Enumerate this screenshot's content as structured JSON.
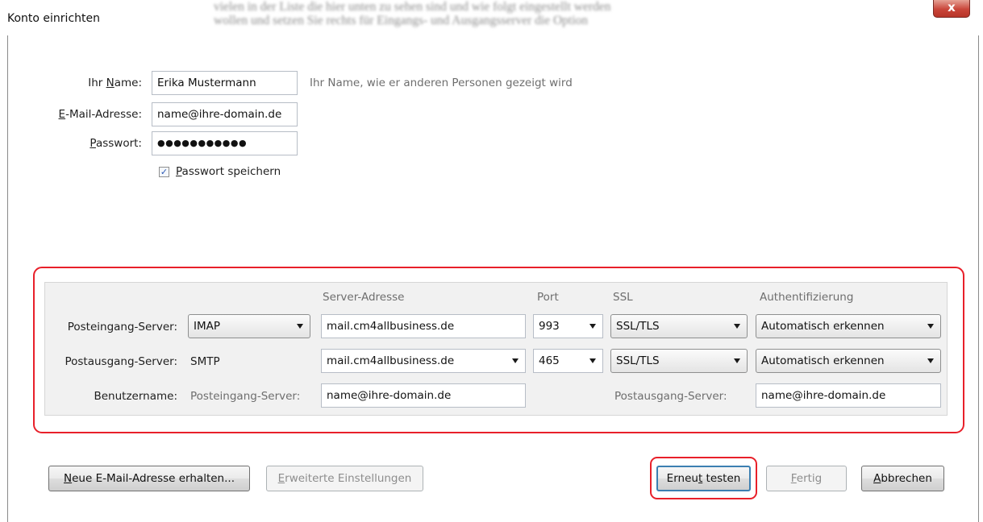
{
  "window": {
    "title": "Konto einrichten",
    "blurred_line1": "vielen in der Liste die hier unten zu sehen sind und wie folgt eingestellt werden",
    "blurred_line2": "wollen und setzen Sie rechts für Eingangs- und Ausgangsserver die Option",
    "close_glyph": "x"
  },
  "identity": {
    "name_label": {
      "pre": "Ihr ",
      "key": "N",
      "post": "ame:"
    },
    "name_value": "Erika Mustermann",
    "name_hint": "Ihr Name, wie er anderen Personen gezeigt wird",
    "email_label": {
      "key": "E",
      "post": "-Mail-Adresse:"
    },
    "email_value": "name@ihre-domain.de",
    "password_label": {
      "key": "P",
      "post": "asswort:"
    },
    "password_value": "●●●●●●●●●●●",
    "save_password": {
      "checked": true,
      "check_glyph": "✓",
      "key": "P",
      "post": "asswort speichern"
    }
  },
  "server_table": {
    "headers": {
      "server_address": "Server-Adresse",
      "port": "Port",
      "ssl": "SSL",
      "auth": "Authentifizierung"
    },
    "incoming": {
      "label": "Posteingang-Server:",
      "protocol": "IMAP",
      "address": "mail.cm4allbusiness.de",
      "port": "993",
      "ssl": "SSL/TLS",
      "auth": "Automatisch erkennen"
    },
    "outgoing": {
      "label": "Postausgang-Server:",
      "protocol": "SMTP",
      "address": "mail.cm4allbusiness.de",
      "port": "465",
      "ssl": "SSL/TLS",
      "auth": "Automatisch erkennen"
    },
    "username": {
      "label": "Benutzername:",
      "incoming_label": "Posteingang-Server:",
      "incoming_value": "name@ihre-domain.de",
      "outgoing_label": "Postausgang-Server:",
      "outgoing_value": "name@ihre-domain.de"
    }
  },
  "buttons": {
    "new_address": {
      "key": "N",
      "post": "eue E-Mail-Adresse erhalten..."
    },
    "advanced": {
      "key": "E",
      "post": "rweiterte Einstellungen"
    },
    "retest": {
      "pre": "Erneu",
      "key": "t",
      "post": " testen"
    },
    "done": {
      "key": "F",
      "post": "ertig"
    },
    "cancel": {
      "key": "A",
      "post": "bbrechen"
    }
  },
  "colors": {
    "highlight": "#e8202a",
    "close_button": "#c9463a",
    "panel_bg": "#f1f1f1"
  }
}
